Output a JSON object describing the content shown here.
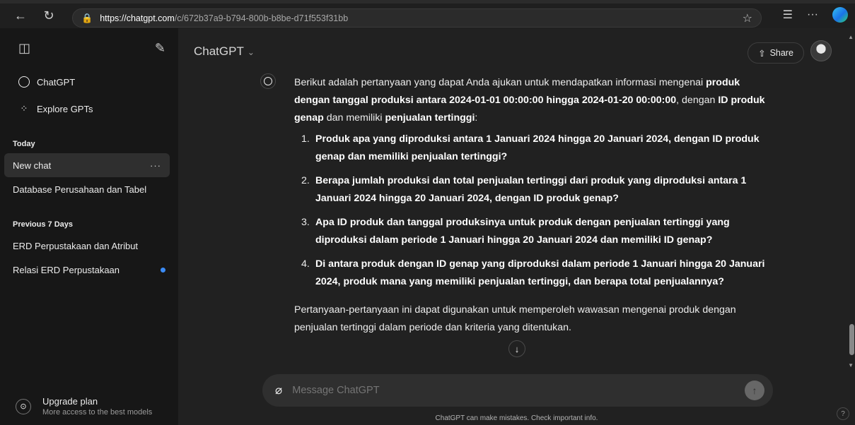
{
  "browser": {
    "url_host": "https://chatgpt.com",
    "url_path": "/c/672b37a9-b794-800b-b8be-d71f553f31bb"
  },
  "sidebar": {
    "items": [
      {
        "label": "ChatGPT"
      },
      {
        "label": "Explore GPTs"
      }
    ],
    "sections": [
      {
        "title": "Today",
        "chats": [
          {
            "label": "New chat",
            "active": true
          },
          {
            "label": "Database Perusahaan dan Tabel"
          }
        ]
      },
      {
        "title": "Previous 7 Days",
        "chats": [
          {
            "label": "ERD Perpustakaan dan Atribut"
          },
          {
            "label": "Relasi ERD Perpustakaan"
          }
        ]
      }
    ],
    "upgrade": {
      "title": "Upgrade plan",
      "subtitle": "More access to the best models"
    }
  },
  "header": {
    "model": "ChatGPT",
    "share_label": "Share"
  },
  "message": {
    "intro_1": "Berikut adalah pertanyaan yang dapat Anda ajukan untuk mendapatkan informasi mengenai ",
    "intro_b1": "produk dengan tanggal produksi antara 2024-01-01 00:00:00 hingga 2024-01-20 00:00:00",
    "intro_2": ", dengan ",
    "intro_b2": "ID produk genap",
    "intro_3": " dan memiliki ",
    "intro_b3": "penjualan tertinggi",
    "intro_4": ":",
    "questions": [
      {
        "num": "1.",
        "text": "Produk apa yang diproduksi antara 1 Januari 2024 hingga 20 Januari 2024, dengan ID produk genap dan memiliki penjualan tertinggi?"
      },
      {
        "num": "2.",
        "text": "Berapa jumlah produksi dan total penjualan tertinggi dari produk yang diproduksi antara 1 Januari 2024 hingga 20 Januari 2024, dengan ID produk genap?"
      },
      {
        "num": "3.",
        "text": "Apa ID produk dan tanggal produksinya untuk produk dengan penjualan tertinggi yang diproduksi dalam periode 1 Januari hingga 20 Januari 2024 dan memiliki ID genap?"
      },
      {
        "num": "4.",
        "text": "Di antara produk dengan ID genap yang diproduksi dalam periode 1 Januari hingga 20 Januari 2024, produk mana yang memiliki penjualan tertinggi, dan berapa total penjualannya?"
      }
    ],
    "outro": "Pertanyaan-pertanyaan ini dapat digunakan untuk memperoleh wawasan mengenai produk dengan penjualan tertinggi dalam periode dan kriteria yang ditentukan."
  },
  "composer": {
    "placeholder": "Message ChatGPT",
    "disclaimer": "ChatGPT can make mistakes. Check important info."
  },
  "help_label": "?",
  "colors": {
    "sidebar_bg": "#171717",
    "main_bg": "#212121",
    "composer_bg": "#2f2f2f",
    "unread_dot": "#3b8bf5"
  }
}
